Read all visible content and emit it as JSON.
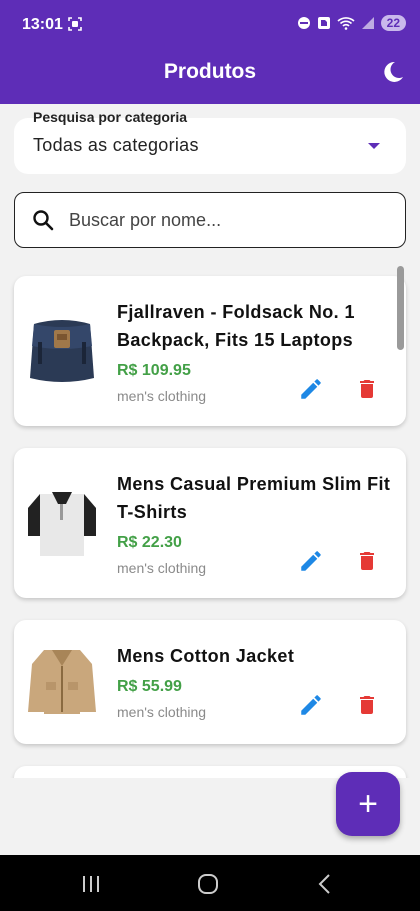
{
  "status": {
    "time": "13:01",
    "battery": "22"
  },
  "appbar": {
    "title": "Produtos",
    "theme_icon": "moon-icon"
  },
  "filter": {
    "label": "Pesquisa por categoria",
    "value": "Todas as categorias"
  },
  "search": {
    "placeholder": "Buscar por nome..."
  },
  "products": [
    {
      "title": "Fjallraven - Foldsack No. 1 Backpack, Fits 15 Laptops",
      "price": "R$ 109.95",
      "category": "men's clothing"
    },
    {
      "title": "Mens Casual Premium Slim Fit T-Shirts",
      "price": "R$ 22.30",
      "category": "men's clothing"
    },
    {
      "title": "Mens Cotton Jacket",
      "price": "R$ 55.99",
      "category": "men's clothing"
    }
  ],
  "colors": {
    "primary": "#5e2db7",
    "price": "#43a047",
    "edit": "#1e88e5",
    "delete": "#e53935"
  }
}
